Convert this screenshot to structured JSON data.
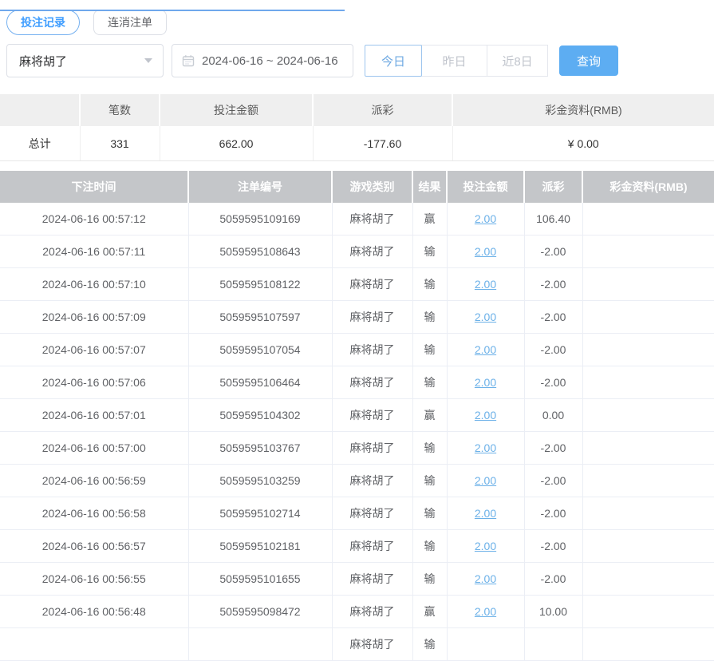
{
  "colors": {
    "accent_blue": "#409eff",
    "search_button_blue": "#5dadf2",
    "link_blue": "#6cb1e8",
    "negative_red": "#f56c6c",
    "table_header_gray": "#c4c6c9",
    "summary_header_gray": "#efefef"
  },
  "tabs": [
    {
      "label": "投注记录",
      "active": true
    },
    {
      "label": "连消注单",
      "active": false
    }
  ],
  "filters": {
    "game_select_value": "麻将胡了",
    "date_range": "2024-06-16 ~ 2024-06-16",
    "quick_buttons": [
      {
        "label": "今日",
        "active": true
      },
      {
        "label": "昨日",
        "active": false
      },
      {
        "label": "近8日",
        "active": false
      }
    ],
    "search_label": "查询"
  },
  "summary": {
    "headers": [
      "",
      "笔数",
      "投注金额",
      "派彩",
      "彩金资料(RMB)"
    ],
    "row_label": "总计",
    "count": "331",
    "bet_amount": "662.00",
    "payout": "-177.60",
    "jackpot": "¥ 0.00"
  },
  "table": {
    "headers": [
      "下注时间",
      "注单编号",
      "游戏类别",
      "结果",
      "投注金额",
      "派彩",
      "彩金资料(RMB)"
    ],
    "rows": [
      {
        "time": "2024-06-16 00:57:12",
        "order_id": "5059595109169",
        "game": "麻将胡了",
        "result": "赢",
        "amount": "2.00",
        "payout": "106.40",
        "jackpot": ""
      },
      {
        "time": "2024-06-16 00:57:11",
        "order_id": "5059595108643",
        "game": "麻将胡了",
        "result": "输",
        "amount": "2.00",
        "payout": "-2.00",
        "jackpot": ""
      },
      {
        "time": "2024-06-16 00:57:10",
        "order_id": "5059595108122",
        "game": "麻将胡了",
        "result": "输",
        "amount": "2.00",
        "payout": "-2.00",
        "jackpot": ""
      },
      {
        "time": "2024-06-16 00:57:09",
        "order_id": "5059595107597",
        "game": "麻将胡了",
        "result": "输",
        "amount": "2.00",
        "payout": "-2.00",
        "jackpot": ""
      },
      {
        "time": "2024-06-16 00:57:07",
        "order_id": "5059595107054",
        "game": "麻将胡了",
        "result": "输",
        "amount": "2.00",
        "payout": "-2.00",
        "jackpot": ""
      },
      {
        "time": "2024-06-16 00:57:06",
        "order_id": "5059595106464",
        "game": "麻将胡了",
        "result": "输",
        "amount": "2.00",
        "payout": "-2.00",
        "jackpot": ""
      },
      {
        "time": "2024-06-16 00:57:01",
        "order_id": "5059595104302",
        "game": "麻将胡了",
        "result": "赢",
        "amount": "2.00",
        "payout": "0.00",
        "jackpot": ""
      },
      {
        "time": "2024-06-16 00:57:00",
        "order_id": "5059595103767",
        "game": "麻将胡了",
        "result": "输",
        "amount": "2.00",
        "payout": "-2.00",
        "jackpot": ""
      },
      {
        "time": "2024-06-16 00:56:59",
        "order_id": "5059595103259",
        "game": "麻将胡了",
        "result": "输",
        "amount": "2.00",
        "payout": "-2.00",
        "jackpot": ""
      },
      {
        "time": "2024-06-16 00:56:58",
        "order_id": "5059595102714",
        "game": "麻将胡了",
        "result": "输",
        "amount": "2.00",
        "payout": "-2.00",
        "jackpot": ""
      },
      {
        "time": "2024-06-16 00:56:57",
        "order_id": "5059595102181",
        "game": "麻将胡了",
        "result": "输",
        "amount": "2.00",
        "payout": "-2.00",
        "jackpot": ""
      },
      {
        "time": "2024-06-16 00:56:55",
        "order_id": "5059595101655",
        "game": "麻将胡了",
        "result": "输",
        "amount": "2.00",
        "payout": "-2.00",
        "jackpot": ""
      },
      {
        "time": "2024-06-16 00:56:48",
        "order_id": "5059595098472",
        "game": "麻将胡了",
        "result": "赢",
        "amount": "2.00",
        "payout": "10.00",
        "jackpot": ""
      },
      {
        "time": "",
        "order_id": "",
        "game": "麻将胡了",
        "result": "输",
        "amount": "",
        "payout": "",
        "jackpot": ""
      }
    ]
  }
}
